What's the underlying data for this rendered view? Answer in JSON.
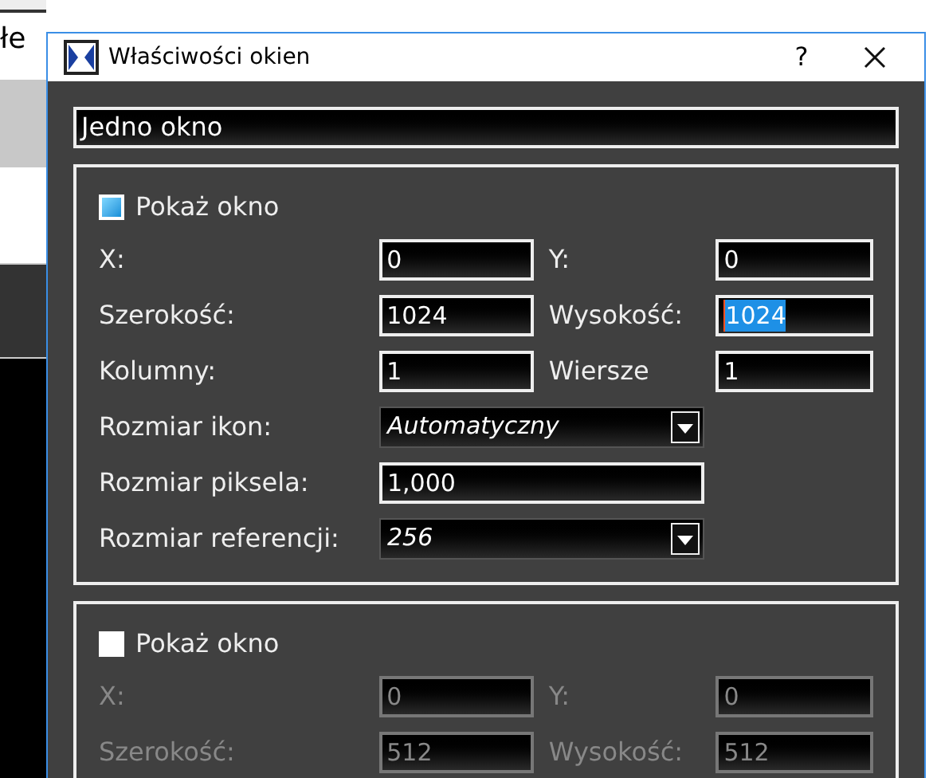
{
  "background": {
    "text": "łe"
  },
  "window": {
    "title": "Właściwości okien",
    "help": "?"
  },
  "name_field": {
    "value": "Jedno okno"
  },
  "groups": [
    {
      "show_window": {
        "label": "Pokaż okno",
        "checked": true
      },
      "disabled": false,
      "rows": [
        {
          "kind": "pair",
          "left": {
            "label": "X:",
            "value": "0",
            "text_selected": false
          },
          "right": {
            "label": "Y:",
            "value": "0",
            "text_selected": false
          }
        },
        {
          "kind": "pair",
          "left": {
            "label": "Szerokość:",
            "value": "1024",
            "text_selected": false
          },
          "right": {
            "label": "Wysokość:",
            "value": "1024",
            "text_selected": true
          }
        },
        {
          "kind": "pair",
          "left": {
            "label": "Kolumny:",
            "value": "1",
            "text_selected": false
          },
          "right": {
            "label": "Wiersze",
            "value": "1",
            "text_selected": false
          }
        },
        {
          "kind": "dropdown",
          "label": "Rozmiar ikon:",
          "value": "Automatyczny"
        },
        {
          "kind": "single",
          "label": "Rozmiar piksela:",
          "value": "1,000"
        },
        {
          "kind": "dropdown",
          "label": "Rozmiar referencji:",
          "value": "256"
        }
      ]
    },
    {
      "show_window": {
        "label": "Pokaż okno",
        "checked": false
      },
      "disabled": true,
      "rows": [
        {
          "kind": "pair",
          "left": {
            "label": "X:",
            "value": "0",
            "text_selected": false
          },
          "right": {
            "label": "Y:",
            "value": "0",
            "text_selected": false
          }
        },
        {
          "kind": "pair",
          "left": {
            "label": "Szerokość:",
            "value": "512",
            "text_selected": false
          },
          "right": {
            "label": "Wysokość:",
            "value": "512",
            "text_selected": false
          }
        }
      ]
    }
  ]
}
